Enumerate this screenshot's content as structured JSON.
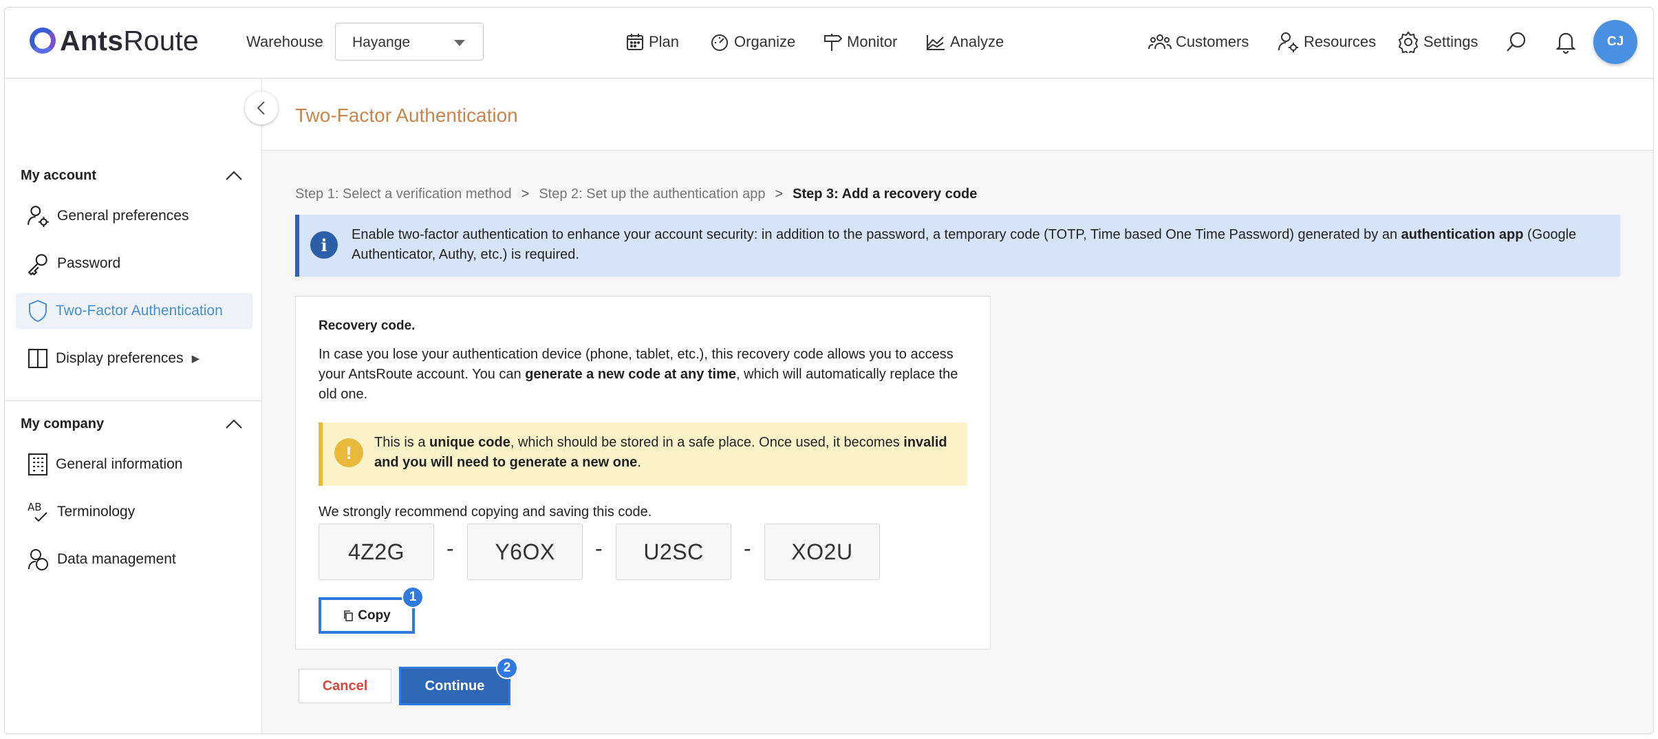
{
  "brand": {
    "name_bold": "Ants",
    "name_light": "Route",
    "accent": "#3b5bd5"
  },
  "header": {
    "warehouse_label": "Warehouse",
    "warehouse_value": "Hayange",
    "nav": {
      "plan": "Plan",
      "organize": "Organize",
      "monitor": "Monitor",
      "analyze": "Analyze"
    },
    "right": {
      "customers": "Customers",
      "resources": "Resources",
      "settings": "Settings"
    },
    "avatar": "CJ"
  },
  "sidebar": {
    "account_title": "My account",
    "account_items": [
      {
        "label": "General preferences",
        "icon": "user-gear-icon"
      },
      {
        "label": "Password",
        "icon": "key-icon"
      },
      {
        "label": "Two-Factor Authentication",
        "icon": "shield-icon",
        "active": true
      },
      {
        "label": "Display preferences",
        "icon": "columns-icon",
        "arrow": "▶"
      }
    ],
    "company_title": "My company",
    "company_items": [
      {
        "label": "General information",
        "icon": "building-icon"
      },
      {
        "label": "Terminology",
        "icon": "ab-check-icon"
      },
      {
        "label": "Data management",
        "icon": "data-management-icon"
      }
    ]
  },
  "page": {
    "title": "Two-Factor Authentication",
    "breadcrumb": {
      "step1": "Step 1: Select a verification method",
      "step2": "Step 2: Set up the authentication app",
      "step3": "Step 3: Add a recovery code",
      "sep": ">"
    },
    "info": {
      "text_pre": "Enable two-factor authentication to enhance your account security: in addition to the password, a temporary code (TOTP, Time based One Time Password) generated by an ",
      "text_bold": "authentication app",
      "text_post": " (Google Authenticator, Authy, etc.) is required."
    },
    "recovery": {
      "title": "Recovery code.",
      "desc_pre": "In case you lose your authentication device (phone, tablet, etc.), this recovery code allows you to access your AntsRoute account. You can ",
      "desc_bold": "generate a new code at any time",
      "desc_post": ", which will automatically replace the old one.",
      "warn_pre": "This is a ",
      "warn_bold1": "unique code",
      "warn_mid": ", which should be stored in a safe place. Once used, it becomes ",
      "warn_bold2": "invalid and you will need to generate a new one",
      "warn_post": ".",
      "hint": "We strongly recommend copying and saving this code.",
      "codes": [
        "4Z2G",
        "Y6OX",
        "U2SC",
        "XO2U"
      ],
      "dash": "-",
      "copy_label": "Copy",
      "copy_badge": "1"
    },
    "actions": {
      "cancel": "Cancel",
      "continue": "Continue",
      "continue_badge": "2"
    }
  },
  "colors": {
    "title": "#c9844c",
    "primary": "#2e67b6",
    "highlight": "#2f79df",
    "info_bg": "#d6e4f8",
    "warn_bg": "#fcf2c9",
    "cancel": "#d64a3e"
  }
}
